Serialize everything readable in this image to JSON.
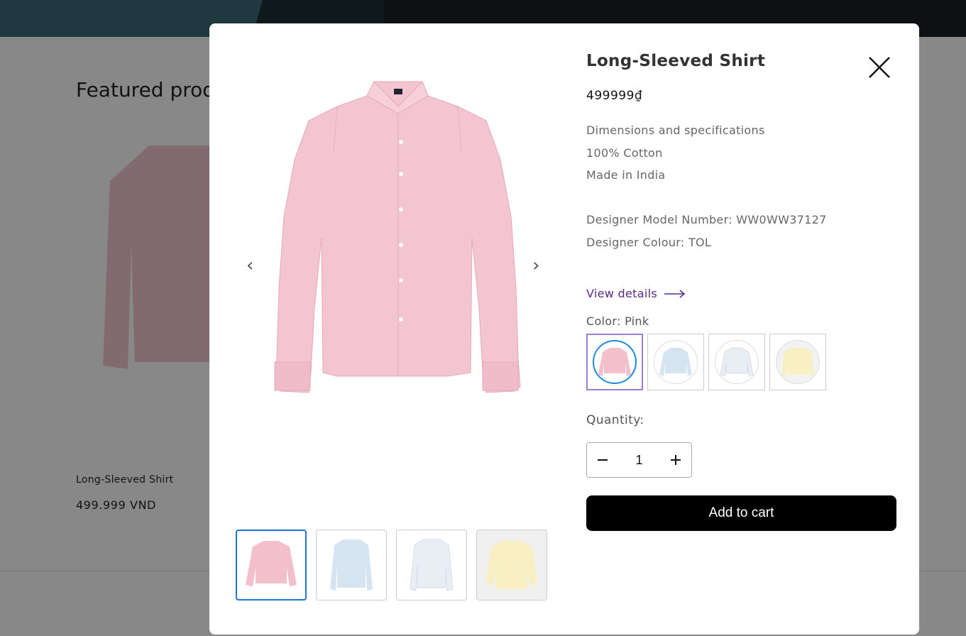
{
  "background": {
    "section_title": "Featured prod",
    "card": {
      "name": "Long-Sleeved Shirt",
      "price": "499.999 VND"
    }
  },
  "modal": {
    "title": "Long-Sleeved Shirt",
    "price": "499999₫",
    "description": [
      "Dimensions and specifications",
      "100% Cotton",
      "Made in India",
      "",
      "Designer Model Number: WW0WW37127",
      "Designer Colour: TOL"
    ],
    "view_details": "View details",
    "color_label": "Color: Pink",
    "swatches": [
      {
        "name": "Pink",
        "color": "#f2bfcb",
        "selected": true
      },
      {
        "name": "Light Blue",
        "color": "#d6e4f2",
        "selected": false
      },
      {
        "name": "White",
        "color": "#eef1f5",
        "selected": false
      },
      {
        "name": "Yellow",
        "color": "#f8efc2",
        "selected": false
      }
    ],
    "quantity_label": "Quantity:",
    "quantity_value": "1",
    "add_to_cart": "Add to cart",
    "prev_arrow": "‹",
    "next_arrow": "›",
    "thumbnails": [
      "Pink",
      "Light Blue",
      "White",
      "Yellow"
    ]
  },
  "colors": {
    "accent_purple": "#5b2a86",
    "active_thumb_border": "#1f73d6",
    "button_black": "#000000"
  }
}
